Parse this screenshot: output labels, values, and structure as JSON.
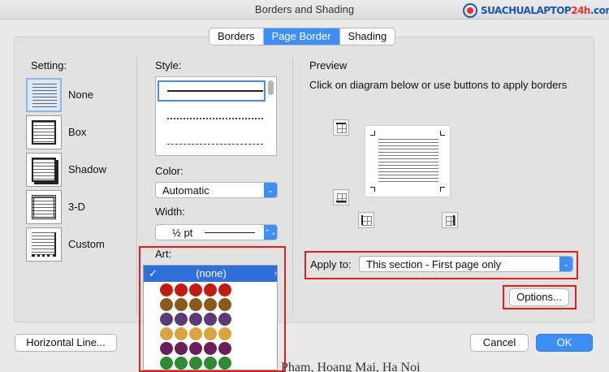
{
  "window": {
    "title": "Borders and Shading"
  },
  "watermark": {
    "text_main": "SUACHUALAPTOP",
    "text_accent": "24h",
    "text_tail": ".com"
  },
  "tabs": [
    {
      "label": "Borders",
      "active": false
    },
    {
      "label": "Page Border",
      "active": true
    },
    {
      "label": "Shading",
      "active": false
    }
  ],
  "setting": {
    "label": "Setting:",
    "options": [
      {
        "label": "None",
        "selected": true
      },
      {
        "label": "Box",
        "selected": false
      },
      {
        "label": "Shadow",
        "selected": false
      },
      {
        "label": "3-D",
        "selected": false
      },
      {
        "label": "Custom",
        "selected": false
      }
    ]
  },
  "style": {
    "label": "Style:"
  },
  "color": {
    "label": "Color:",
    "value": "Automatic"
  },
  "width": {
    "label": "Width:",
    "value": "½ pt"
  },
  "art": {
    "label": "Art:",
    "value": "(none)",
    "check": "✓"
  },
  "preview": {
    "label": "Preview",
    "description": "Click on diagram below or use buttons to apply borders"
  },
  "apply_to": {
    "label": "Apply to:",
    "value": "This section - First page only"
  },
  "buttons": {
    "options": "Options...",
    "horizontal_line": "Horizontal Line...",
    "cancel": "Cancel",
    "ok": "OK"
  },
  "background_text": "Pham, Hoang Mai, Ha Noi",
  "colors": {
    "accent": "#3d8ef7",
    "highlight": "#e0201a"
  },
  "icons": [
    "border-top-icon",
    "border-bottom-icon",
    "border-left-icon",
    "border-right-icon",
    "page-preview-icon",
    "check-icon",
    "chevron-up-down-icon"
  ]
}
